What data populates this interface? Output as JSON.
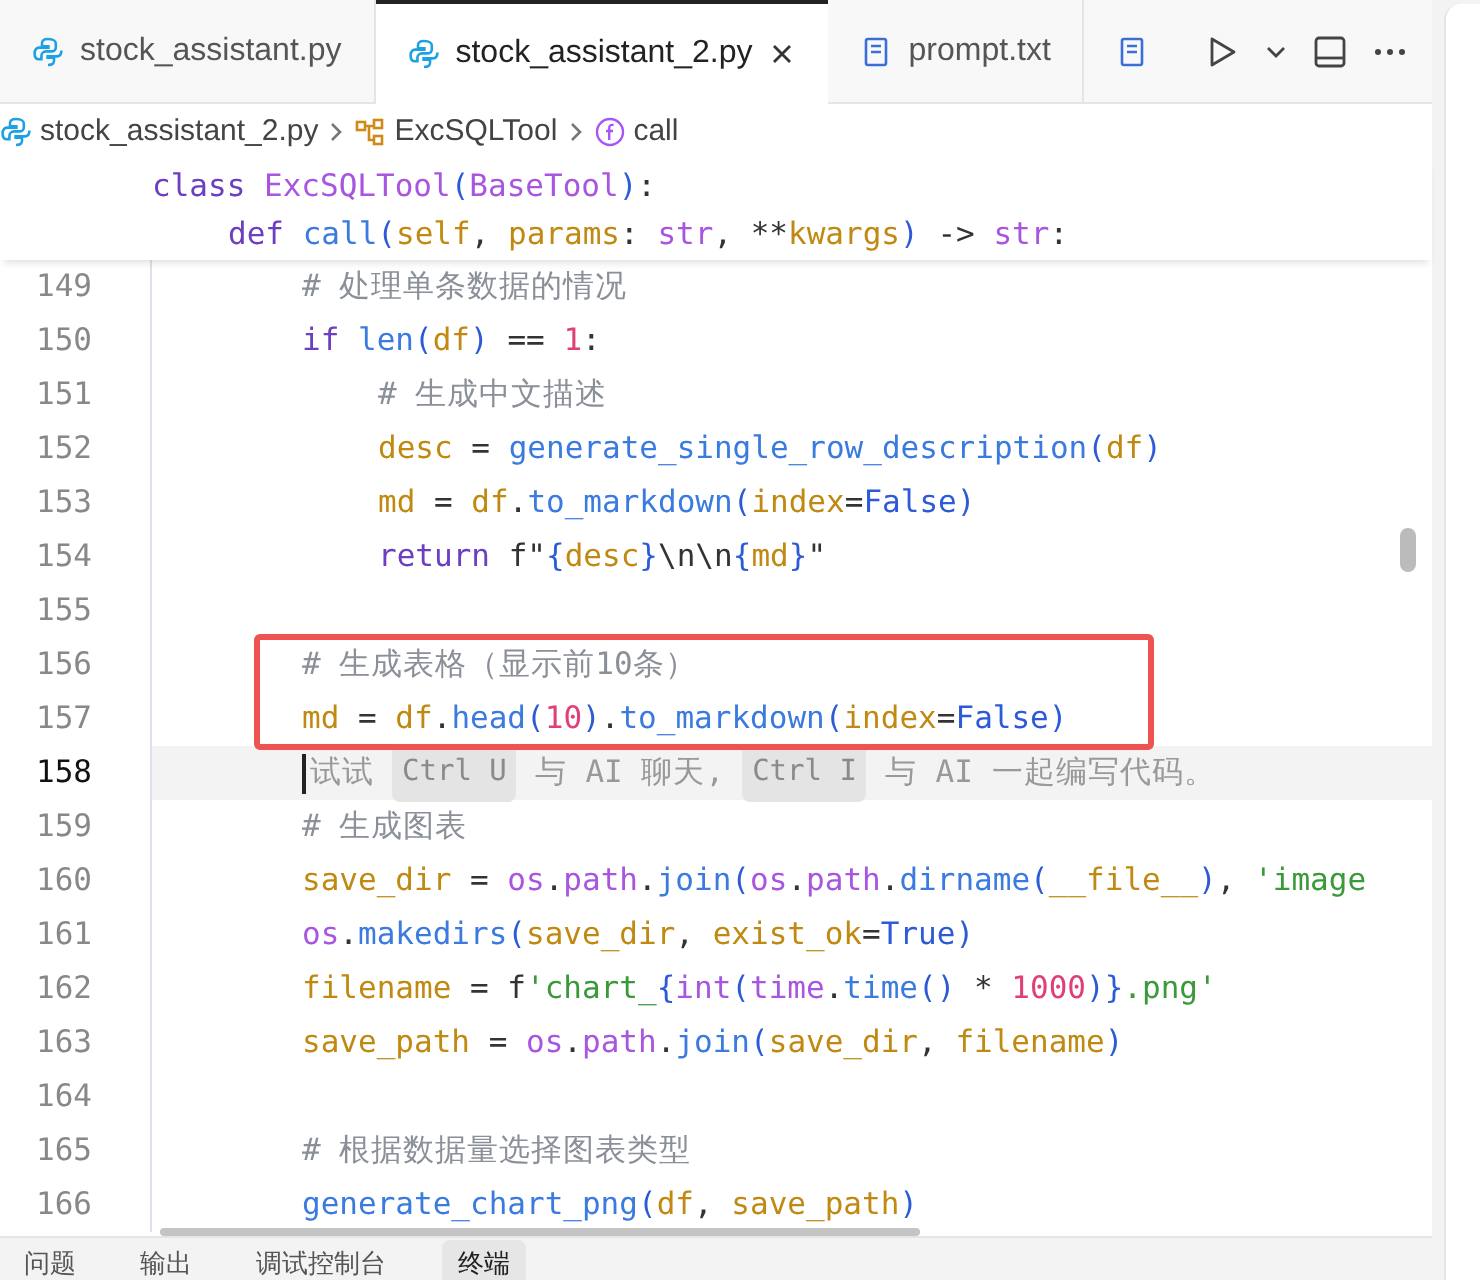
{
  "tabs": [
    {
      "kind": "python",
      "label": "stock_assistant.py",
      "selected": false
    },
    {
      "kind": "python",
      "label": "stock_assistant_2.py",
      "selected": true
    },
    {
      "kind": "text",
      "label": "prompt.txt",
      "selected": false
    },
    {
      "kind": "text",
      "selected": false
    }
  ],
  "breadcrumb": [
    {
      "kind": "python",
      "label": "stock_assistant_2.py"
    },
    {
      "kind": "class",
      "label": "ExcSQLTool"
    },
    {
      "kind": "function",
      "label": "call"
    }
  ],
  "sticky_lines": [
    {
      "tokens": [
        {
          "kind": "kw",
          "t": "class"
        },
        {
          "kind": "cls",
          "t": " ExcSQLTool"
        },
        {
          "kind": "br",
          "t": "("
        },
        {
          "kind": "cls",
          "t": "BaseTool"
        },
        {
          "kind": "br",
          "t": ")"
        },
        {
          "kind": "p",
          "t": ":"
        }
      ],
      "children": [
        {
          "tokens": [
            {
              "kind": "kw",
              "t": "def"
            },
            {
              "kind": "fn",
              "t": " call"
            },
            {
              "kind": "br",
              "t": "("
            },
            {
              "kind": "var",
              "t": "self"
            },
            {
              "kind": "p",
              "t": ","
            },
            {
              "kind": "var",
              "t": " params"
            },
            {
              "kind": "p",
              "t": ":"
            },
            {
              "kind": "cls",
              "t": " str"
            },
            {
              "kind": "p",
              "t": ", **"
            },
            {
              "kind": "var",
              "t": "kwargs"
            },
            {
              "kind": "br",
              "t": ")"
            },
            {
              "kind": "p",
              "t": " -> "
            },
            {
              "kind": "cls",
              "t": "str"
            },
            {
              "kind": "p",
              "t": ":"
            }
          ]
        }
      ]
    }
  ],
  "lines": [
    {
      "number": "149",
      "current": false,
      "boxed": false,
      "kind": "code",
      "tokens": [
        {
          "kind": "cm",
          "t": "# 处理单条数据的情况"
        }
      ]
    },
    {
      "number": "150",
      "current": false,
      "boxed": false,
      "kind": "code",
      "tokens": [
        {
          "kind": "kw",
          "t": "if"
        },
        {
          "kind": "fn",
          "t": " len"
        },
        {
          "kind": "br",
          "t": "("
        },
        {
          "kind": "var",
          "t": "df"
        },
        {
          "kind": "br",
          "t": ")"
        },
        {
          "kind": "p",
          "t": " == "
        },
        {
          "kind": "num",
          "t": "1"
        },
        {
          "kind": "p",
          "t": ":"
        }
      ],
      "children": [
        {
          "number": "151",
          "current": false,
          "boxed": false,
          "kind": "code",
          "tokens": [
            {
              "kind": "cm",
              "t": "# 生成中文描述"
            }
          ]
        },
        {
          "number": "152",
          "current": false,
          "boxed": false,
          "kind": "code",
          "tokens": [
            {
              "kind": "var",
              "t": "desc"
            },
            {
              "kind": "p",
              "t": " = "
            },
            {
              "kind": "fn",
              "t": "generate_single_row_description"
            },
            {
              "kind": "br",
              "t": "("
            },
            {
              "kind": "var",
              "t": "df"
            },
            {
              "kind": "br",
              "t": ")"
            }
          ]
        },
        {
          "number": "153",
          "current": false,
          "boxed": false,
          "kind": "code",
          "tokens": [
            {
              "kind": "var",
              "t": "md"
            },
            {
              "kind": "p",
              "t": " = "
            },
            {
              "kind": "var",
              "t": "df"
            },
            {
              "kind": "p",
              "t": "."
            },
            {
              "kind": "fn",
              "t": "to_markdown"
            },
            {
              "kind": "br",
              "t": "("
            },
            {
              "kind": "var",
              "t": "index"
            },
            {
              "kind": "p",
              "t": "="
            },
            {
              "kind": "const",
              "t": "False"
            },
            {
              "kind": "br",
              "t": ")"
            }
          ]
        },
        {
          "number": "154",
          "current": false,
          "boxed": false,
          "kind": "code",
          "tokens": [
            {
              "kind": "kw",
              "t": "return"
            },
            {
              "kind": "p",
              "t": " f\""
            },
            {
              "kind": "br",
              "t": "{"
            },
            {
              "kind": "var",
              "t": "desc"
            },
            {
              "kind": "br",
              "t": "}"
            },
            {
              "kind": "p",
              "t": "\\n\\n"
            },
            {
              "kind": "br",
              "t": "{"
            },
            {
              "kind": "var",
              "t": "md"
            },
            {
              "kind": "br",
              "t": "}"
            },
            {
              "kind": "p",
              "t": "\""
            }
          ]
        }
      ]
    },
    {
      "number": "155",
      "current": false,
      "boxed": false,
      "kind": "code"
    },
    {
      "number": "156",
      "current": false,
      "boxed": true,
      "kind": "code",
      "tokens": [
        {
          "kind": "cm",
          "t": "# 生成表格（显示前10条）"
        }
      ]
    },
    {
      "number": "157",
      "current": false,
      "boxed": true,
      "kind": "code",
      "tokens": [
        {
          "kind": "var",
          "t": "md"
        },
        {
          "kind": "p",
          "t": " = "
        },
        {
          "kind": "var",
          "t": "df"
        },
        {
          "kind": "p",
          "t": "."
        },
        {
          "kind": "fn",
          "t": "head"
        },
        {
          "kind": "br",
          "t": "("
        },
        {
          "kind": "num",
          "t": "10"
        },
        {
          "kind": "br",
          "t": ")"
        },
        {
          "kind": "p",
          "t": "."
        },
        {
          "kind": "fn",
          "t": "to_markdown"
        },
        {
          "kind": "br",
          "t": "("
        },
        {
          "kind": "var",
          "t": "index"
        },
        {
          "kind": "p",
          "t": "="
        },
        {
          "kind": "const",
          "t": "False"
        },
        {
          "kind": "br",
          "t": ")"
        }
      ]
    },
    {
      "number": "158",
      "current": true,
      "boxed": false,
      "kind": "hint",
      "tokens": [
        {
          "kind": "hint",
          "t": "试试"
        },
        {
          "kind": "kbd",
          "t": "Ctrl U"
        },
        {
          "kind": "hint",
          "t": "与 AI 聊天,"
        },
        {
          "kind": "kbd",
          "t": "Ctrl I"
        },
        {
          "kind": "hint",
          "t": "与 AI 一起编写代码。"
        }
      ]
    },
    {
      "number": "159",
      "current": false,
      "boxed": false,
      "kind": "code",
      "tokens": [
        {
          "kind": "cm",
          "t": "# 生成图表"
        }
      ]
    },
    {
      "number": "160",
      "current": false,
      "boxed": false,
      "kind": "code",
      "tokens": [
        {
          "kind": "var",
          "t": "save_dir"
        },
        {
          "kind": "p",
          "t": " = "
        },
        {
          "kind": "cls",
          "t": "os"
        },
        {
          "kind": "p",
          "t": "."
        },
        {
          "kind": "cls",
          "t": "path"
        },
        {
          "kind": "p",
          "t": "."
        },
        {
          "kind": "fn",
          "t": "join"
        },
        {
          "kind": "br",
          "t": "("
        },
        {
          "kind": "cls",
          "t": "os"
        },
        {
          "kind": "p",
          "t": "."
        },
        {
          "kind": "cls",
          "t": "path"
        },
        {
          "kind": "p",
          "t": "."
        },
        {
          "kind": "fn",
          "t": "dirname"
        },
        {
          "kind": "br",
          "t": "("
        },
        {
          "kind": "var",
          "t": "__file__"
        },
        {
          "kind": "br",
          "t": ")"
        },
        {
          "kind": "p",
          "t": ","
        },
        {
          "kind": "str",
          "t": " 'image"
        }
      ]
    },
    {
      "number": "161",
      "current": false,
      "boxed": false,
      "kind": "code",
      "tokens": [
        {
          "kind": "cls",
          "t": "os"
        },
        {
          "kind": "p",
          "t": "."
        },
        {
          "kind": "fn",
          "t": "makedirs"
        },
        {
          "kind": "br",
          "t": "("
        },
        {
          "kind": "var",
          "t": "save_dir"
        },
        {
          "kind": "p",
          "t": ","
        },
        {
          "kind": "var",
          "t": " exist_ok"
        },
        {
          "kind": "p",
          "t": "="
        },
        {
          "kind": "const",
          "t": "True"
        },
        {
          "kind": "br",
          "t": ")"
        }
      ]
    },
    {
      "number": "162",
      "current": false,
      "boxed": false,
      "kind": "code",
      "tokens": [
        {
          "kind": "var",
          "t": "filename"
        },
        {
          "kind": "p",
          "t": " = f"
        },
        {
          "kind": "str",
          "t": "'chart_"
        },
        {
          "kind": "br",
          "t": "{"
        },
        {
          "kind": "cls",
          "t": "int"
        },
        {
          "kind": "br",
          "t": "("
        },
        {
          "kind": "cls",
          "t": "time"
        },
        {
          "kind": "p",
          "t": "."
        },
        {
          "kind": "fn",
          "t": "time"
        },
        {
          "kind": "br",
          "t": "()"
        },
        {
          "kind": "p",
          "t": " * "
        },
        {
          "kind": "num",
          "t": "1000"
        },
        {
          "kind": "br",
          "t": ")}"
        },
        {
          "kind": "str",
          "t": ".png'"
        }
      ]
    },
    {
      "number": "163",
      "current": false,
      "boxed": false,
      "kind": "code",
      "tokens": [
        {
          "kind": "var",
          "t": "save_path"
        },
        {
          "kind": "p",
          "t": " = "
        },
        {
          "kind": "cls",
          "t": "os"
        },
        {
          "kind": "p",
          "t": "."
        },
        {
          "kind": "cls",
          "t": "path"
        },
        {
          "kind": "p",
          "t": "."
        },
        {
          "kind": "fn",
          "t": "join"
        },
        {
          "kind": "br",
          "t": "("
        },
        {
          "kind": "var",
          "t": "save_dir"
        },
        {
          "kind": "p",
          "t": ","
        },
        {
          "kind": "var",
          "t": " filename"
        },
        {
          "kind": "br",
          "t": ")"
        }
      ]
    },
    {
      "number": "164",
      "current": false,
      "boxed": false,
      "kind": "code"
    },
    {
      "number": "165",
      "current": false,
      "boxed": false,
      "kind": "code",
      "tokens": [
        {
          "kind": "cm",
          "t": "# 根据数据量选择图表类型"
        }
      ]
    },
    {
      "number": "166",
      "current": false,
      "boxed": false,
      "kind": "code",
      "tokens": [
        {
          "kind": "fn",
          "t": "generate_chart_png"
        },
        {
          "kind": "br",
          "t": "("
        },
        {
          "kind": "var",
          "t": "df"
        },
        {
          "kind": "p",
          "t": ","
        },
        {
          "kind": "var",
          "t": " save_path"
        },
        {
          "kind": "br",
          "t": ")"
        }
      ]
    }
  ],
  "panel_tabs": [
    {
      "label": "问题",
      "selected": false
    },
    {
      "label": "输出",
      "selected": false
    },
    {
      "label": "调试控制台",
      "selected": false
    },
    {
      "label": "终端",
      "selected": true
    }
  ]
}
